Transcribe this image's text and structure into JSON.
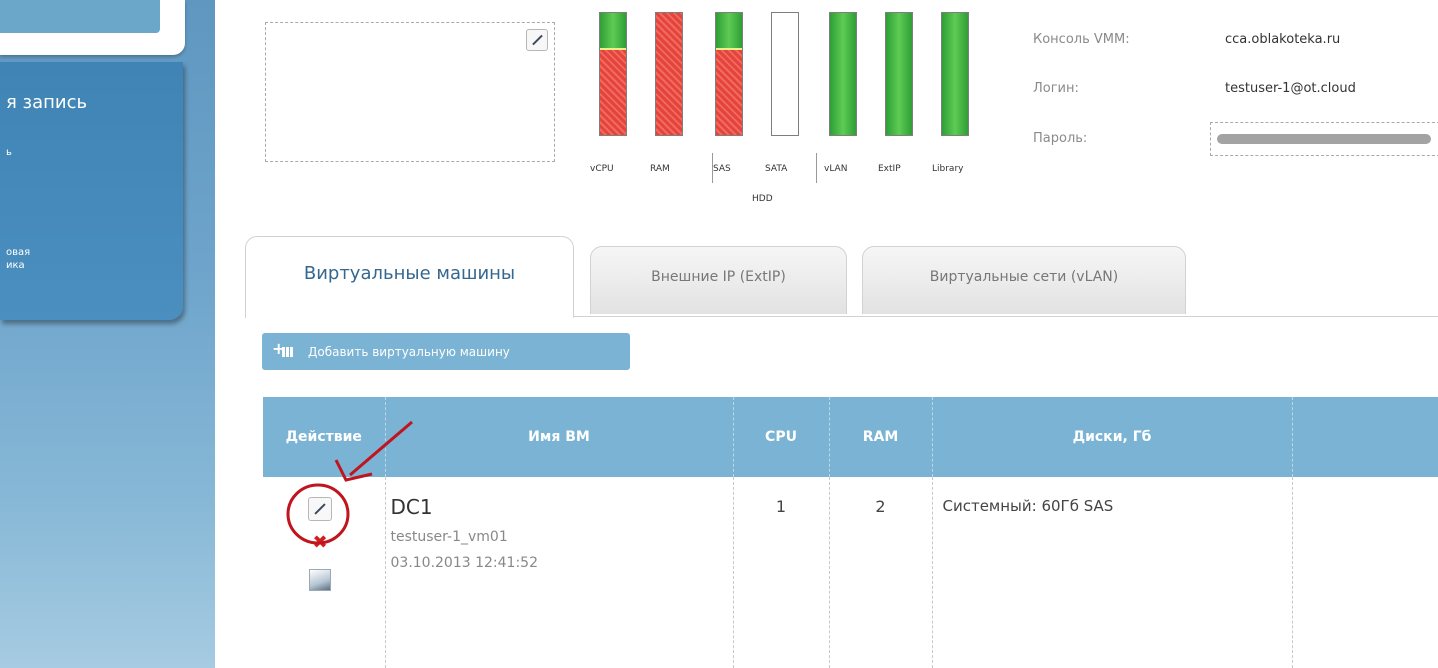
{
  "sidebar": {
    "account_label": "я запись",
    "item1": "ь",
    "item2_line1": "овая",
    "item2_line2": "ика"
  },
  "resources": {
    "labels": [
      "vCPU",
      "RAM",
      "SAS",
      "SATA",
      "vLAN",
      "ExtIP",
      "Library"
    ],
    "used_fraction": [
      0.7,
      1.0,
      0.7,
      0.0,
      0.0,
      0.0,
      0.0
    ],
    "free_fraction": [
      0.3,
      0.0,
      0.3,
      0.0,
      1.0,
      1.0,
      1.0
    ],
    "hdd_group_label": "HDD",
    "colors": {
      "free": "#43b543",
      "used": "#e5443c"
    }
  },
  "console": {
    "vmm_label": "Консоль VMM:",
    "vmm_value": "cca.oblakoteka.ru",
    "login_label": "Логин:",
    "login_value": "testuser-1@ot.cloud",
    "password_label": "Пароль:"
  },
  "tabs": [
    {
      "label": "Виртуальные машины",
      "active": true
    },
    {
      "label": "Внешние IP (ExtIP)",
      "active": false
    },
    {
      "label": "Виртуальные сети (vLAN)",
      "active": false
    }
  ],
  "add_vm_label": "Добавить виртуальную машину",
  "table": {
    "headers": [
      "Действие",
      "Имя ВМ",
      "CPU",
      "RAM",
      "Диски, Гб",
      ""
    ],
    "rows": [
      {
        "name": "DC1",
        "id": "testuser-1_vm01",
        "created": "03.10.2013 12:41:52",
        "cpu": "1",
        "ram": "2",
        "disks": "Системный: 60Гб SAS"
      }
    ]
  },
  "accent_color": "#7ab3d3"
}
